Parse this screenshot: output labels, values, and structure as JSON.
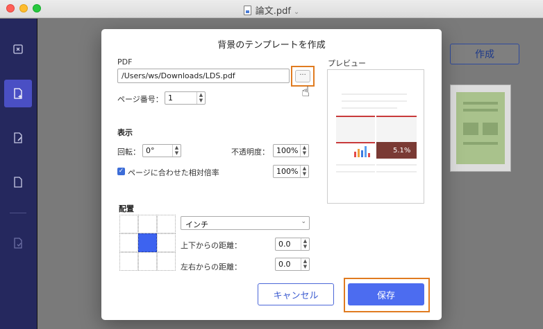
{
  "window": {
    "title": "論文.pdf"
  },
  "background": {
    "create_button": "作成"
  },
  "dialog": {
    "title": "背景のテンプレートを作成",
    "pdf_label": "PDF",
    "pdf_path": "/Users/ws/Downloads/LDS.pdf",
    "browse_label": "···",
    "page_number_label": "ページ番号：",
    "page_number_value": "1",
    "display_section": "表示",
    "rotation_label": "回転：",
    "rotation_value": "0°",
    "opacity_label": "不透明度：",
    "opacity_value": "100%",
    "fit_page_label": "ページに合わせた相対倍率",
    "fit_page_checked": true,
    "scale_value": "100%",
    "placement_section": "配置",
    "unit_select": "インチ",
    "vertical_distance_label": "上下からの距離：",
    "vertical_distance_value": "0.0",
    "horizontal_distance_label": "左右からの距離：",
    "horizontal_distance_value": "0.0",
    "preview_label": "プレビュー",
    "preview_percent": "5.1%",
    "cancel_label": "キャンセル",
    "save_label": "保存"
  },
  "colors": {
    "sidebar": "#25285e",
    "sidebar_active": "#4a4fc4",
    "primary": "#4c6cf0",
    "highlight": "#e07b20"
  },
  "sidebar_icons": [
    "close-box-icon",
    "add-page-icon",
    "edit-page-icon",
    "blank-page-icon",
    "check-page-icon"
  ]
}
